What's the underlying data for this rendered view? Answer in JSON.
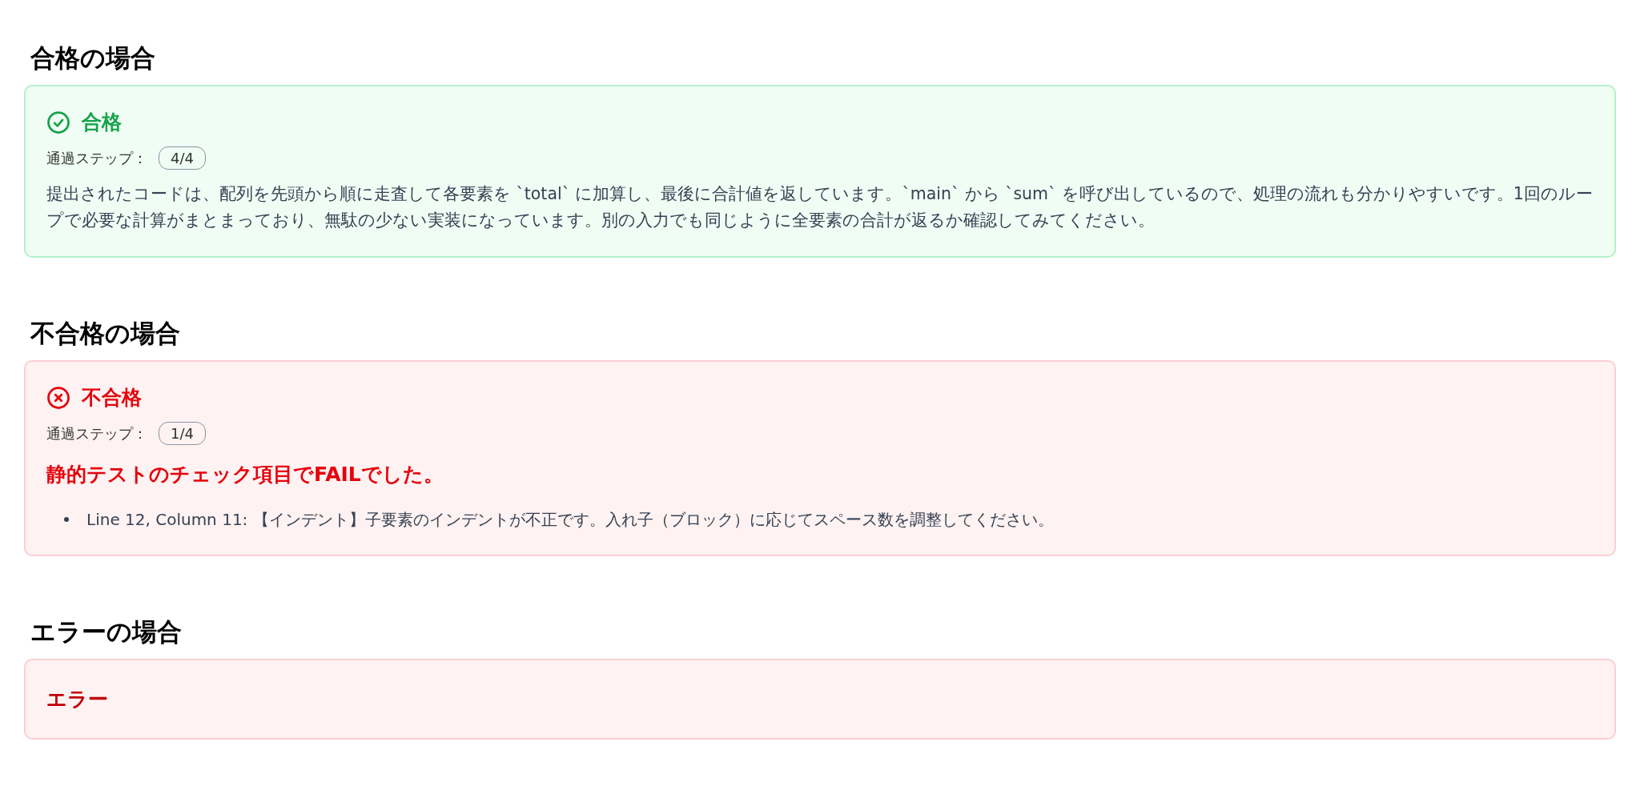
{
  "sections": [
    {
      "heading": "合格の場合",
      "result": {
        "kind": "pass",
        "title": "合格",
        "steps_label": "通過ステップ：",
        "steps": "4/4",
        "message": "提出されたコードは、配列を先頭から順に走査して各要素を `total` に加算し、最後に合計値を返しています。`main` から `sum` を呼び出しているので、処理の流れも分かりやすいです。1回のループで必要な計算がまとまっており、無駄の少ない実装になっています。別の入力でも同じように全要素の合計が返るか確認してみてください。"
      }
    },
    {
      "heading": "不合格の場合",
      "result": {
        "kind": "fail",
        "title": "不合格",
        "steps_label": "通過ステップ：",
        "steps": "1/4",
        "headline": "静的テストのチェック項目でFAILでした。",
        "items": [
          "Line 12, Column 11: 【インデント】子要素のインデントが不正です。入れ子（ブロック）に応じてスペース数を調整してください。"
        ]
      }
    },
    {
      "heading": "エラーの場合",
      "result": {
        "kind": "error",
        "title": "エラー"
      }
    }
  ]
}
